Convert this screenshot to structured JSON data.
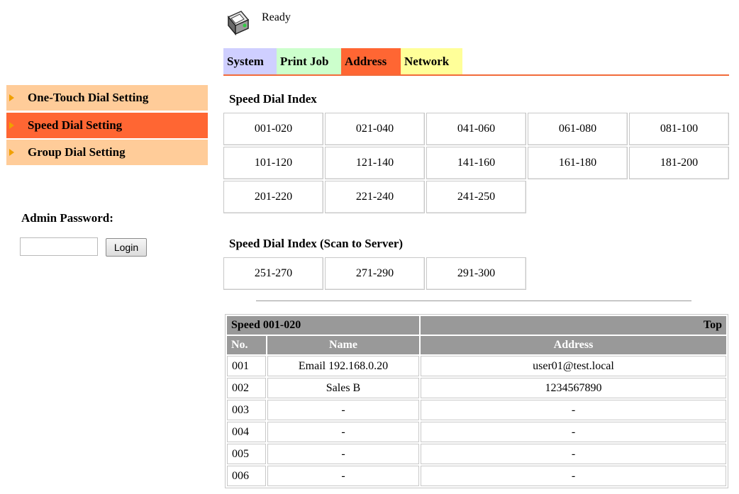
{
  "status": {
    "icon": "printer-icon",
    "text": "Ready"
  },
  "tabs": [
    {
      "label": "System"
    },
    {
      "label": "Print Job"
    },
    {
      "label": "Address"
    },
    {
      "label": "Network"
    }
  ],
  "sidebar": {
    "items": [
      {
        "label": "One-Touch Dial Setting"
      },
      {
        "label": "Speed Dial Setting"
      },
      {
        "label": "Group Dial Setting"
      }
    ],
    "admin_label": "Admin Password:",
    "password_value": "",
    "login_label": "Login"
  },
  "speed_index": {
    "title": "Speed Dial Index",
    "ranges": [
      "001-020",
      "021-040",
      "041-060",
      "061-080",
      "081-100",
      "101-120",
      "121-140",
      "141-160",
      "161-180",
      "181-200",
      "201-220",
      "221-240",
      "241-250"
    ]
  },
  "scan_index": {
    "title": "Speed Dial Index (Scan to Server)",
    "ranges": [
      "251-270",
      "271-290",
      "291-300"
    ]
  },
  "table": {
    "title": "Speed 001-020",
    "top_link": "Top",
    "columns": [
      "No.",
      "Name",
      "Address"
    ],
    "rows": [
      [
        "001",
        "Email 192.168.0.20",
        "user01@test.local"
      ],
      [
        "002",
        "Sales B",
        "1234567890"
      ],
      [
        "003",
        "-",
        "-"
      ],
      [
        "004",
        "-",
        "-"
      ],
      [
        "005",
        "-",
        "-"
      ],
      [
        "006",
        "-",
        "-"
      ]
    ]
  },
  "colors": {
    "active": "#ff6633",
    "accent_line": "#f26b3a",
    "sidebar_bg": "#ffcc99"
  }
}
